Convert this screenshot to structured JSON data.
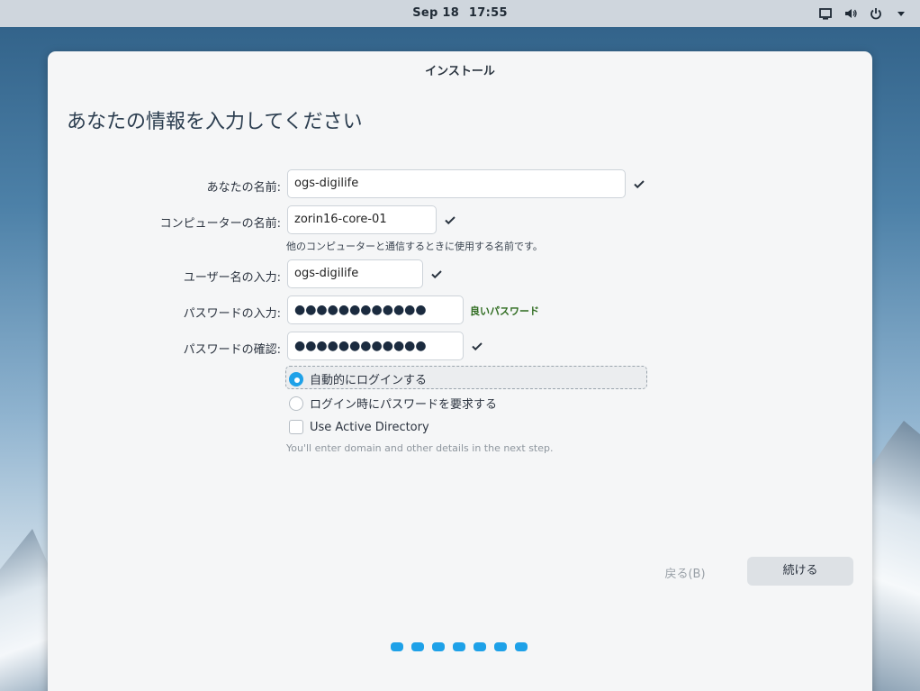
{
  "topbar": {
    "date": "Sep 18",
    "time": "17:55",
    "icons": [
      "display-icon",
      "volume-icon",
      "power-icon",
      "menu-arrow-icon"
    ]
  },
  "window": {
    "title": "インストール",
    "page_title": "あなたの情報を入力してください"
  },
  "form": {
    "name_label": "あなたの名前:",
    "name_value": "ogs-digilife",
    "computer_label": "コンピューターの名前:",
    "computer_value": "zorin16-core-01",
    "computer_hint": "他のコンピューターと通信するときに使用する名前です。",
    "username_label": "ユーザー名の入力:",
    "username_value": "ogs-digilife",
    "password_label": "パスワードの入力:",
    "password_mask": "●●●●●●●●●●●●",
    "password_strength": "良いパスワード",
    "confirm_label": "パスワードの確認:",
    "confirm_mask": "●●●●●●●●●●●●"
  },
  "options": {
    "auto_login": "自動的にログインする",
    "require_password": "ログイン時にパスワードを要求する",
    "active_directory": "Use Active Directory",
    "ad_hint": "You'll enter domain and other details in the next step.",
    "selected": "auto_login",
    "active_directory_checked": false
  },
  "buttons": {
    "back": "戻る(B)",
    "next": "続ける"
  },
  "progress": {
    "steps": 7
  },
  "colors": {
    "accent": "#1ea1e8",
    "good_password": "#2e6b1f"
  }
}
